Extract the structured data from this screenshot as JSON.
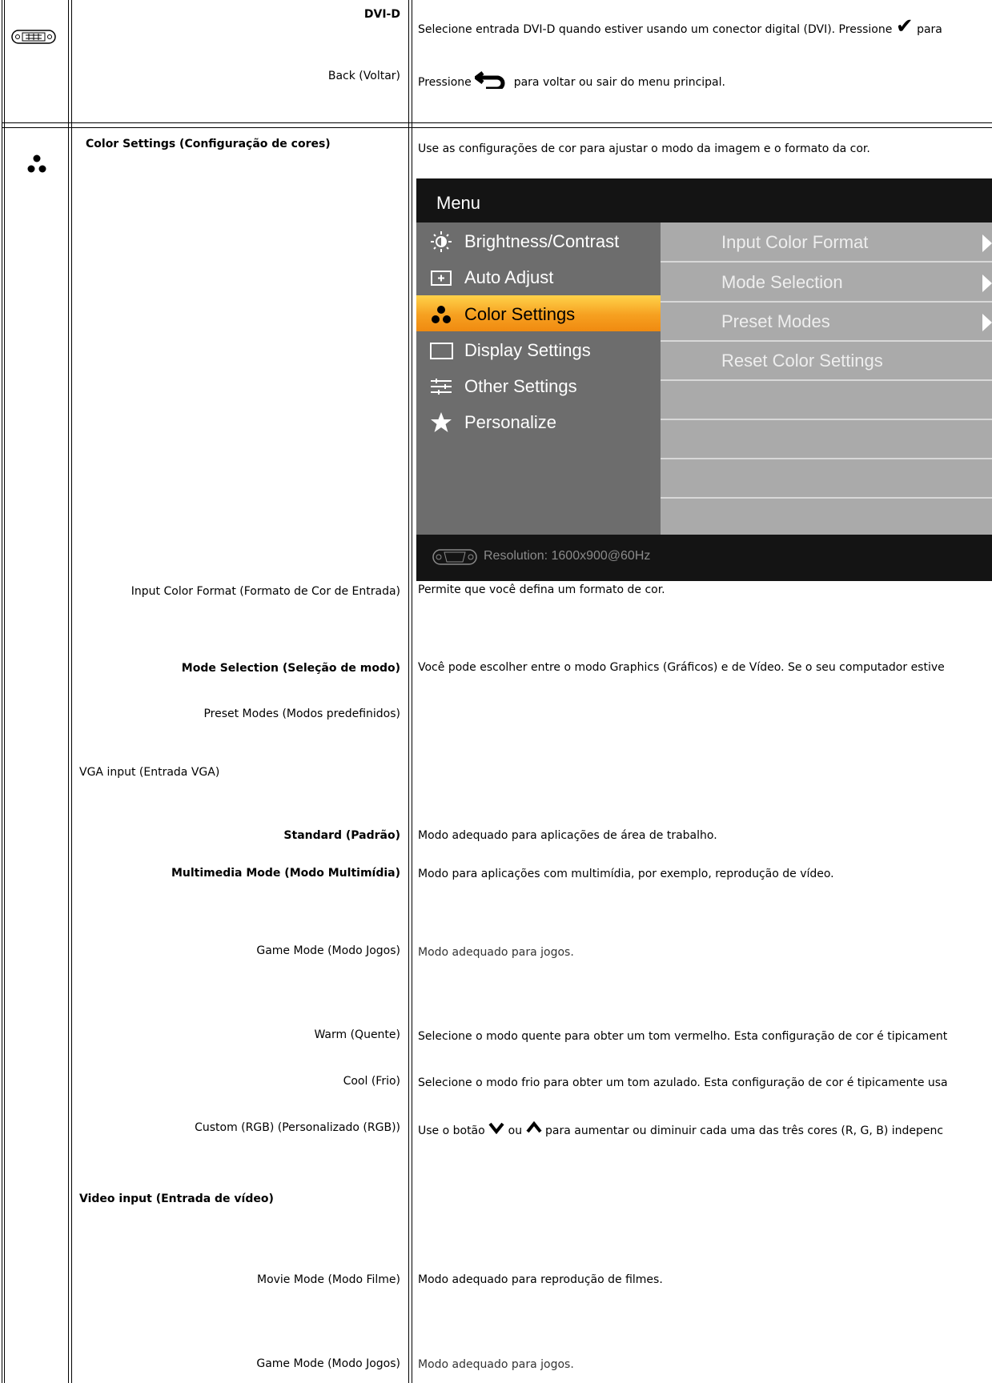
{
  "rows_top": {
    "dvid_label": "DVI-D",
    "dvid_desc_before": "Selecione entrada DVI-D quando estiver usando um conector digital (DVI). Pressione",
    "dvid_desc_after": "para",
    "back_label": "Back (Voltar)",
    "back_desc_before": "Pressione",
    "back_desc_after": "para voltar ou sair do menu principal."
  },
  "color_settings": {
    "header": "Color Settings (Configuração de cores)",
    "intro": "Use as configurações de cor para ajustar o modo da imagem e o formato da cor."
  },
  "osd": {
    "title": "Menu",
    "left_items": [
      "Brightness/Contrast",
      "Auto Adjust",
      "Color Settings",
      "Display Settings",
      "Other Settings",
      "Personalize"
    ],
    "selected_index": 2,
    "right_items": [
      "Input Color Format",
      "Mode Selection",
      "Preset Modes",
      "Reset Color Settings"
    ],
    "footer": "Resolution: 1600x900@60Hz",
    "colors": {
      "left_bg": "#6d6d6d",
      "right_bg": "#aaaaaa",
      "highlight": "#f6a020",
      "frame": "#141414"
    }
  },
  "rows": [
    {
      "label": "Input Color Format (Formato de Cor de Entrada)",
      "desc": "Permite que você defina um formato de cor."
    },
    {
      "label": "Mode Selection (Seleção de modo)",
      "desc": "Você pode escolher entre o modo Graphics (Gráficos) e de Vídeo. Se o seu computador estive"
    },
    {
      "label": "Preset Modes (Modos predefinidos)",
      "desc": ""
    },
    {
      "label": "VGA input (Entrada VGA)",
      "desc": ""
    },
    {
      "label": "Standard (Padrão)",
      "desc": "Modo adequado para aplicações de área de trabalho."
    },
    {
      "label": "Multimedia Mode (Modo Multimídia)",
      "desc": "Modo para aplicações com multimídia, por exemplo, reprodução de vídeo."
    },
    {
      "label": "Game Mode (Modo Jogos)",
      "desc": "Modo adequado para jogos."
    },
    {
      "label": "Warm (Quente)",
      "desc": "Selecione o modo quente para obter um tom vermelho. Esta configuração de cor é tipicament"
    },
    {
      "label": "Cool (Frio)",
      "desc": "Selecione o modo frio para obter um tom azulado. Esta configuração de cor é tipicamente usa"
    },
    {
      "label": "Custom (RGB) (Personalizado (RGB))",
      "desc_before": "Use o botão",
      "desc_mid": "ou",
      "desc_after": "para aumentar ou diminuir cada uma das três cores (R, G, B) indepenc"
    },
    {
      "label": "Video input (Entrada de vídeo)",
      "desc": ""
    },
    {
      "label": "Movie Mode (Modo Filme)",
      "desc": "Modo adequado para reprodução de filmes."
    },
    {
      "label": "Game Mode (Modo Jogos)",
      "desc": "Modo adequado para jogos."
    }
  ]
}
